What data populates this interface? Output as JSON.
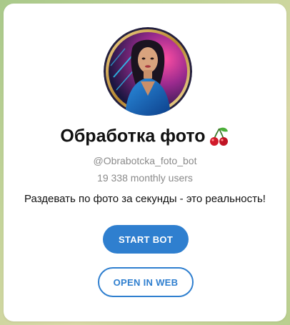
{
  "bot": {
    "name": "Обработка фото",
    "emoji_icon": "cherries-icon",
    "username": "@Obrabotcka_foto_bot",
    "monthly_users": "19 338 monthly users",
    "description": "Раздевать по фото за секунды - это реальность!"
  },
  "buttons": {
    "start_label": "START BOT",
    "web_label": "OPEN IN WEB"
  },
  "colors": {
    "accent": "#2f7fcf",
    "title": "#111111",
    "secondary_text": "#8a8a8a",
    "card": "#ffffff",
    "background": "#b9cf8f"
  }
}
